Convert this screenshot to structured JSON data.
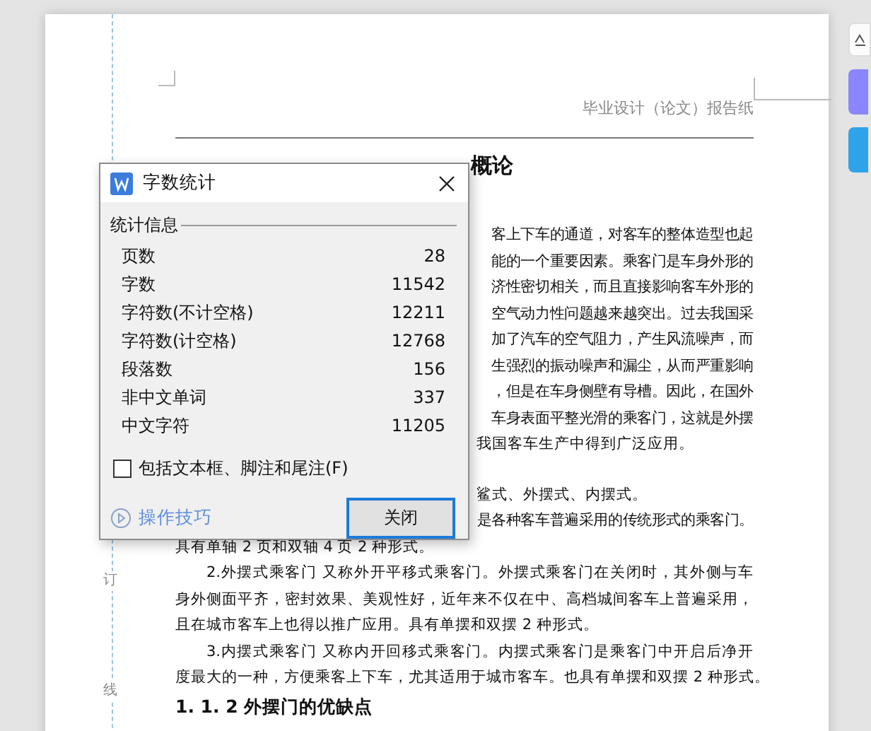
{
  "document": {
    "header": "毕业设计（论文）报告纸",
    "title_fragment": "概论",
    "binding_marks": [
      "订",
      "线"
    ],
    "lines_upper": [
      {
        "kind": "right_fragment",
        "text": "客上下车的通道，对客车的整体造型也起"
      },
      {
        "kind": "right_fragment",
        "text": "能的一个重要因素。乘客门是车身外形的"
      },
      {
        "kind": "right_fragment",
        "text": "济性密切相关，而且直接影响客车外形的"
      },
      {
        "kind": "right_fragment",
        "text": "空气动力性问题越来越突出。过去我国采"
      },
      {
        "kind": "right_fragment",
        "text": "加了汽车的空气阻力，产生风流噪声，而"
      },
      {
        "kind": "right_fragment",
        "text": "生强烈的振动噪声和漏尘，从而严重影响"
      },
      {
        "kind": "right_fragment",
        "text": "，但是在车身侧壁有导槽。因此，在国外"
      },
      {
        "kind": "right_fragment",
        "text": "车身表面平整光滑的乘客门，这就是外摆"
      },
      {
        "kind": "left_fragment",
        "text": "我国客车生产中得到广泛应用。"
      }
    ],
    "lines_lower": [
      {
        "kind": "left_fragment",
        "text": "鲨式、外摆式、内摆式。"
      },
      {
        "kind": "right_fragment",
        "text": "是各种客车普遍采用的传统形式的乘客门。"
      },
      {
        "kind": "paragraph_end",
        "text": "具有单轴 2 页和双轴 4 页 2 种形式。"
      },
      {
        "kind": "paragraph_start",
        "text": "2.外摆式乘客门 又称外开平移式乘客门。外摆式乘客门在关闭时，其外侧与车"
      },
      {
        "kind": "line",
        "text": "身外侧面平齐，密封效果、美观性好，近年来不仅在中、高档城间客车上普遍采用，"
      },
      {
        "kind": "paragraph_end",
        "text": "且在城市客车上也得以推广应用。具有单摆和双摆 2 种形式。"
      },
      {
        "kind": "paragraph_start",
        "text": "3.内摆式乘客门 又称内开回移式乘客门。内摆式乘客门是乘客门中开启后净开"
      },
      {
        "kind": "paragraph_end",
        "text": "度最大的一种，方便乘客上下车，尤其适用于城市客车。也具有单摆和双摆 2 种形式。"
      },
      {
        "kind": "heading",
        "text": "1. 1. 2 外摆门的优缺点"
      }
    ]
  },
  "dialog": {
    "title": "字数统计",
    "group_label": "统计信息",
    "stats": [
      {
        "label": "页数",
        "value": "28"
      },
      {
        "label": "字数",
        "value": "11542"
      },
      {
        "label": "字符数(不计空格)",
        "value": "12211"
      },
      {
        "label": "字符数(计空格)",
        "value": "12768"
      },
      {
        "label": "段落数",
        "value": "156"
      },
      {
        "label": "非中文单词",
        "value": "337"
      },
      {
        "label": "中文字符",
        "value": "11205"
      }
    ],
    "include_option": {
      "label": "包括文本框、脚注和尾注(F)",
      "checked": false
    },
    "tips_link": "操作技巧",
    "close_button": "关闭"
  }
}
